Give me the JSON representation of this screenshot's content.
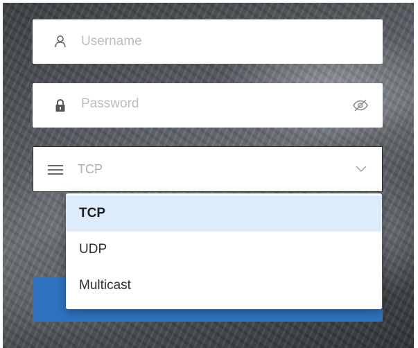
{
  "username": {
    "placeholder": "Username",
    "icon": "user-icon"
  },
  "password": {
    "placeholder": "Password",
    "icon": "lock-icon",
    "toggle_icon": "eye-slash-icon"
  },
  "protocol": {
    "selected": "TCP",
    "icon": "menu-icon",
    "options": [
      {
        "label": "TCP",
        "selected": true
      },
      {
        "label": "UDP",
        "selected": false
      },
      {
        "label": "Multicast",
        "selected": false
      }
    ]
  },
  "colors": {
    "accent": "#2f73c0",
    "selected_option_bg": "#dcecfb",
    "placeholder": "#b9bcc0"
  }
}
